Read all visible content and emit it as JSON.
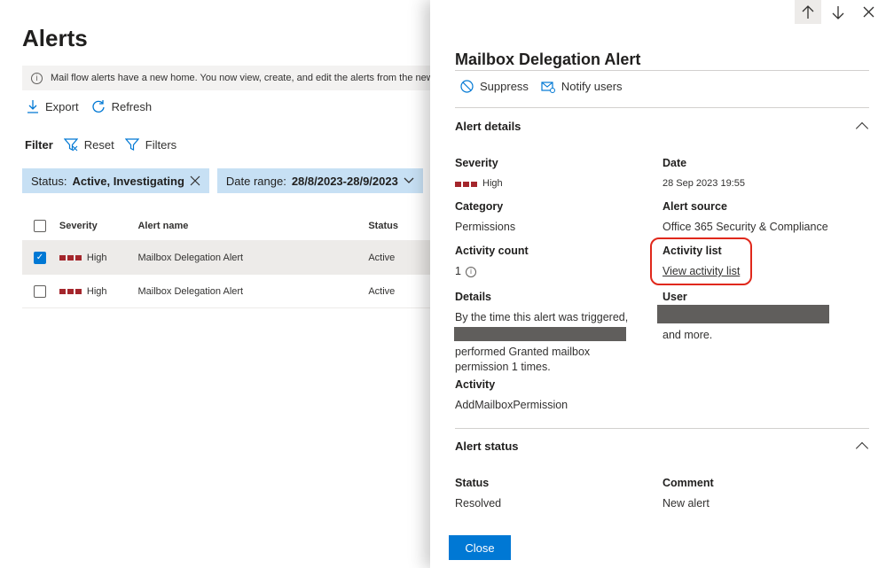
{
  "page": {
    "title": "Alerts",
    "banner": "Mail flow alerts have a new home. You now view, create, and edit the alerts from the new Ex",
    "commands": {
      "export": "Export",
      "refresh": "Refresh"
    },
    "filter": {
      "label": "Filter",
      "reset": "Reset",
      "filters": "Filters"
    },
    "pills": [
      {
        "key": "Status:",
        "value": "Active, Investigating"
      },
      {
        "key": "Date range:",
        "value": "28/8/2023-28/9/2023"
      }
    ],
    "table": {
      "headers": {
        "severity": "Severity",
        "name": "Alert name",
        "status": "Status"
      },
      "rows": [
        {
          "severity": "High",
          "name": "Mailbox Delegation Alert",
          "status": "Active",
          "selected": true
        },
        {
          "severity": "High",
          "name": "Mailbox Delegation Alert",
          "status": "Active",
          "selected": false
        }
      ]
    }
  },
  "panel": {
    "title": "Mailbox Delegation Alert",
    "actions": {
      "suppress": "Suppress",
      "notify": "Notify users"
    },
    "details_section": "Alert details",
    "severity": {
      "label": "Severity",
      "value": "High"
    },
    "date": {
      "label": "Date",
      "value": "28 Sep 2023 19:55"
    },
    "category": {
      "label": "Category",
      "value": "Permissions"
    },
    "source": {
      "label": "Alert source",
      "value": "Office 365 Security & Compliance"
    },
    "activity_count": {
      "label": "Activity count",
      "value": "1"
    },
    "activity_list": {
      "label": "Activity list",
      "link": "View activity list"
    },
    "details": {
      "label": "Details",
      "line1": "By the time this alert was triggered,",
      "line2": "performed Granted mailbox",
      "line3": "permission 1 times."
    },
    "user": {
      "label": "User",
      "more": "and more."
    },
    "activity": {
      "label": "Activity",
      "value": "AddMailboxPermission"
    },
    "status_section": "Alert status",
    "status": {
      "label": "Status",
      "value": "Resolved"
    },
    "comment": {
      "label": "Comment",
      "value": "New alert"
    },
    "close": "Close"
  },
  "colors": {
    "accent": "#0078d4",
    "severity_high": "#a4262c",
    "pill": "#c7e0f4",
    "highlight": "#e0281b"
  },
  "icons": [
    "info-icon",
    "download-icon",
    "refresh-icon",
    "filter-icon",
    "close-icon",
    "chevron-down-icon",
    "arrow-up-icon",
    "arrow-down-icon",
    "suppress-icon",
    "notify-icon",
    "chevron-up-icon"
  ]
}
